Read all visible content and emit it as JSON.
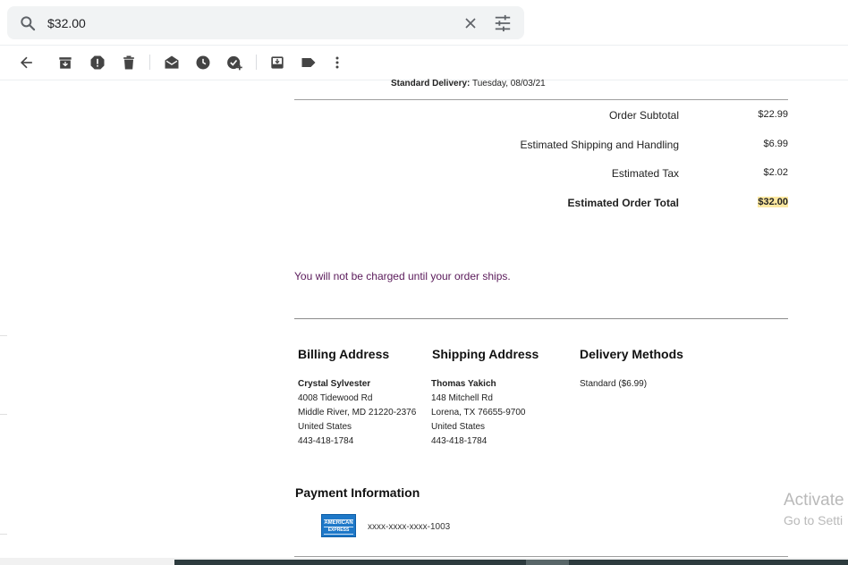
{
  "search": {
    "query": "$32.00"
  },
  "icons": {
    "search": "search-icon",
    "clear": "close-icon",
    "tune": "tune-icon"
  },
  "toolbar": [
    {
      "icon": "back-arrow-icon",
      "label": "Back"
    },
    {
      "icon": "archive-icon",
      "label": "Archive"
    },
    {
      "icon": "report-spam-icon",
      "label": "Report spam"
    },
    {
      "icon": "delete-icon",
      "label": "Delete"
    },
    {
      "icon": "mark-unread-icon",
      "label": "Mark as unread"
    },
    {
      "icon": "snooze-icon",
      "label": "Snooze"
    },
    {
      "icon": "add-task-icon",
      "label": "Add to Tasks"
    },
    {
      "icon": "move-to-icon",
      "label": "Move to"
    },
    {
      "icon": "label-icon",
      "label": "Labels"
    },
    {
      "icon": "more-vertical-icon",
      "label": "More"
    }
  ],
  "email": {
    "delivery_label": "Standard Delivery:",
    "delivery_date": " Tuesday, 08/03/21",
    "summary": [
      {
        "label": "Order Subtotal",
        "value": "$22.99"
      },
      {
        "label": "Estimated Shipping and Handling",
        "value": "$6.99"
      },
      {
        "label": "Estimated Tax",
        "value": "$2.02"
      },
      {
        "label": "Estimated Order Total",
        "value": "$32.00"
      }
    ],
    "notice": "You will not be charged until your order ships.",
    "billing": {
      "title": "Billing Address",
      "name": "Crystal Sylvester",
      "lines": [
        "4008 Tidewood Rd",
        "Middle River, MD 21220-2376",
        "United States",
        "443-418-1784"
      ]
    },
    "shipping": {
      "title": "Shipping Address",
      "name": "Thomas Yakich",
      "lines": [
        "148 Mitchell Rd",
        "Lorena, TX 76655-9700",
        "United States",
        "443-418-1784"
      ]
    },
    "delivery_methods": {
      "title": "Delivery Methods",
      "value": "Standard ($6.99)"
    },
    "payment": {
      "title": "Payment Information",
      "card_brand_line1": "AMERICAN",
      "card_brand_line2": "EXPRESS",
      "card_number": "xxxx-xxxx-xxxx-1003"
    }
  },
  "watermark": {
    "line1": "Activate",
    "line2": "Go to Setti"
  },
  "colors": {
    "highlight": "#fce8a0",
    "notice": "#5a1a5a",
    "amex": "#1e78c8"
  }
}
